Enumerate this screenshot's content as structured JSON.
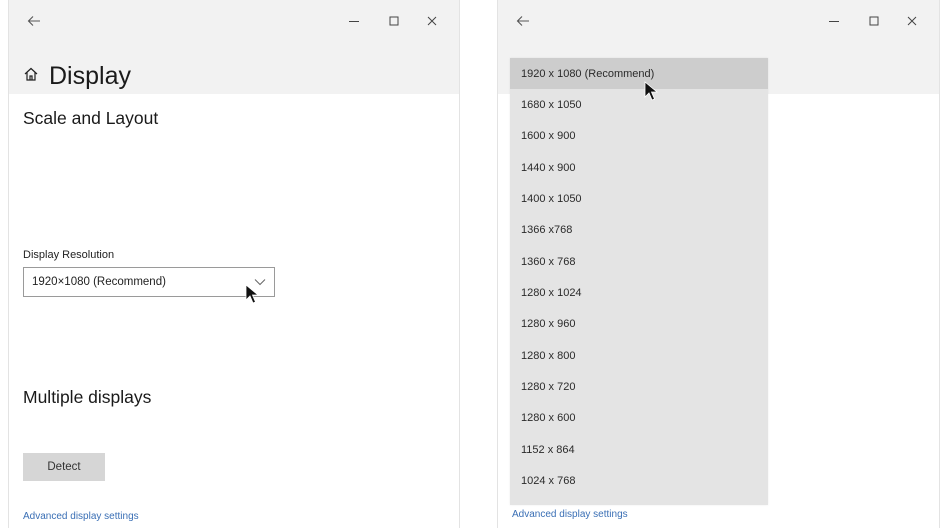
{
  "left": {
    "title": "Display",
    "section_scale": "Scale and Layout",
    "resolution_label": "Display Resolution",
    "resolution_value": "1920×1080  (Recommend)",
    "section_multiple": "Multiple displays",
    "detect_label": "Detect",
    "advanced_link": "Advanced display settings"
  },
  "right": {
    "resolutions": [
      "1920 x 1080 (Recommend)",
      "1680 x 1050",
      "1600 x 900",
      "1440 x 900",
      "1400 x 1050",
      "1366 x768",
      "1360 x 768",
      "1280 x 1024",
      "1280 x 960",
      "1280 x 800",
      "1280 x 720",
      "1280 x 600",
      "1152 x 864",
      "1024 x 768"
    ],
    "advanced_link": "Advanced display settings"
  },
  "icons": {
    "back": "back-arrow-icon",
    "minimize": "minimize-icon",
    "maximize": "maximize-icon",
    "close": "close-icon",
    "home": "home-icon",
    "chevron": "chevron-down-icon",
    "cursor": "mouse-cursor-icon"
  },
  "colors": {
    "header_bg": "#f2f2f2",
    "dropdown_bg": "#e4e4e4",
    "selected_bg": "#cdcdcd",
    "link": "#3a6fb5",
    "button_bg": "#d6d6d6"
  }
}
